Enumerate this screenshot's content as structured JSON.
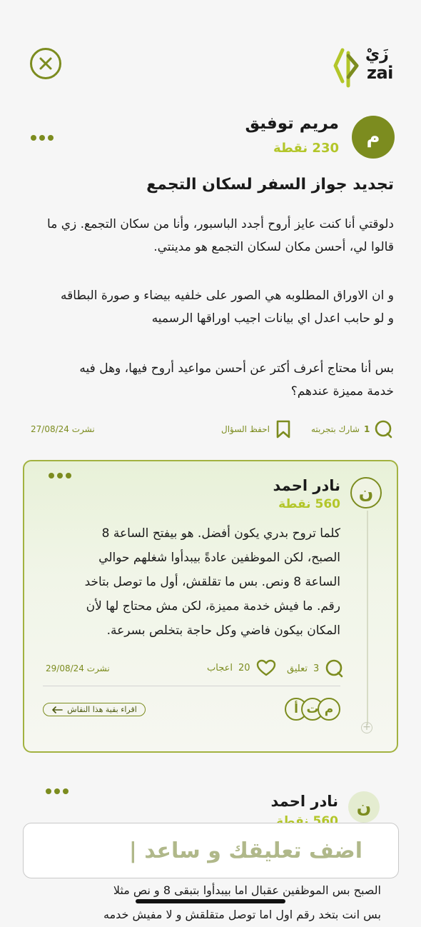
{
  "header": {
    "close_icon": "close-circle-icon",
    "logo_ar": "زَيْ",
    "logo_en": "zai"
  },
  "post": {
    "avatar_initial": "م",
    "author_name": "مريم توفيق",
    "author_points": "230 نقطة",
    "title": "تجديد جواز السفر لسكان التجمع",
    "paragraphs": [
      [
        "دلوقتي أنا كنت عايز أروح أجدد الباسبور، وأنا من سكان التجمع. زي ما",
        "قالوا لي، أحسن مكان لسكان التجمع هو مدينتي."
      ],
      [
        "و ان الاوراق المطلوبه هي الصور على خلفيه بيضاء و صورة البطاقه",
        "و لو حابب اعدل اي بيانات اجيب اوراقها الرسميه"
      ],
      [
        "بس أنا محتاج أعرف أكتر عن أحسن مواعيد أروح فيها، وهل فيه",
        "خدمة مميزة عندهم؟"
      ]
    ],
    "share_count": "1",
    "share_label": "شارك بتجربته",
    "save_label": "احفظ السؤال",
    "published": "نشرت 27/08/24"
  },
  "comment": {
    "avatar_initial": "ن",
    "author_name": "نادر احمد",
    "author_points": "560 نقطة",
    "lines": [
      "كلما تروح بدري يكون أفضل. هو بيفتح الساعة 8",
      "الصبح، لكن الموظفين عادةً بيبدأوا شغلهم حوالي",
      "الساعة 8 ونص. بس ما تقلقش، أول ما توصل بتاخد",
      "رقم. ما فيش خدمة مميزة، لكن مش محتاج لها لأن",
      "المكان بيكون فاضي وكل حاجة بتخلص بسرعة."
    ],
    "reply_count": "3",
    "reply_label": "تعليق",
    "like_count": "20",
    "like_label": "اعجاب",
    "published": "نشرت 29/08/24",
    "read_more": "اقراء بقية هذا النقاش",
    "participants": [
      "م",
      "ت",
      "أ"
    ]
  },
  "comment2": {
    "avatar_initial": "ن",
    "author_name": "نادر احمد",
    "author_points": "560 نقطة",
    "lines": [
      "الصبح بس الموظفين عقبال اما بيبدأوا بتبقى 8 و نص مثلا",
      "بس انت بتخد رقم اول اما توصل متقلقش و لا مفيش خدمه"
    ]
  },
  "input": {
    "placeholder": "اضف تعليقك و ساعد |"
  },
  "colors": {
    "accent": "#7c8c1f",
    "points": "#b3c62a",
    "card_border": "#a2b240"
  }
}
